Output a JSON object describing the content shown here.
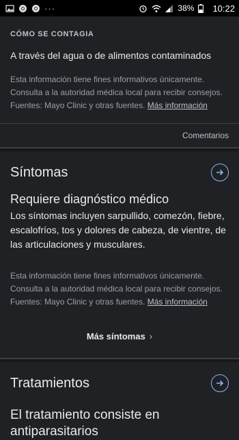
{
  "status_bar": {
    "overflow_dots": "···",
    "battery_percent": "38%",
    "time": "10:22"
  },
  "contagion": {
    "overline": "CÓMO SE CONTAGIA",
    "text": "A través del agua o de alimentos contaminados",
    "disclaimer_line1": "Esta información tiene fines informativos únicamente.",
    "disclaimer_line2": "Consulta a la autoridad médica local para recibir consejos.",
    "disclaimer_line3": "Fuentes: Mayo Clinic y otras fuentes.",
    "more_info_link": "Más información",
    "feedback": "Comentarios"
  },
  "symptoms": {
    "title": "Síntomas",
    "subtitle": "Requiere diagnóstico médico",
    "body": "Los síntomas incluyen sarpullido, comezón, fiebre, escalofríos, tos y dolores de cabeza, de vientre, de las articulaciones y musculares.",
    "disclaimer_line1": "Esta información tiene fines informativos únicamente.",
    "disclaimer_line2": "Consulta a la autoridad médica local para recibir consejos.",
    "disclaimer_line3": "Fuentes: Mayo Clinic y otras fuentes.",
    "more_info_link": "Más información",
    "more_button": "Más síntomas",
    "more_chevron": "›"
  },
  "treatments": {
    "title": "Tratamientos",
    "subtitle": "El tratamiento consiste en antiparasitarios"
  },
  "colors": {
    "background": "#202124",
    "accent": "#8ab4f8",
    "text": "#e8eaed",
    "muted": "#9aa0a6"
  },
  "icons": [
    "chrome-icon",
    "chrome-icon",
    "alarm-icon",
    "wifi-icon",
    "signal-icon",
    "battery-icon",
    "arrow-right-icon"
  ]
}
